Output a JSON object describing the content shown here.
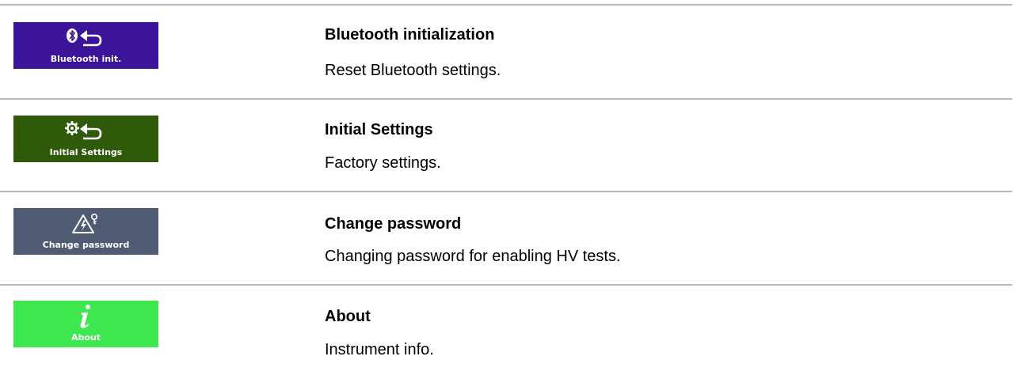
{
  "items": [
    {
      "tile_label": "Bluetooth init.",
      "tile_color": "#3b1499",
      "icon": "bluetooth-reset-icon",
      "title": "Bluetooth initialization",
      "description": "Reset Bluetooth settings."
    },
    {
      "tile_label": "Initial Settings",
      "tile_color": "#2f5a0a",
      "icon": "gear-reset-icon",
      "title": "Initial Settings",
      "description": "Factory settings."
    },
    {
      "tile_label": "Change password",
      "tile_color": "#4f5a73",
      "icon": "hv-password-icon",
      "title": "Change password",
      "description": "Changing password for enabling HV tests."
    },
    {
      "tile_label": "About",
      "tile_color": "#3ee650",
      "icon": "info-icon",
      "title": "About",
      "description": "Instrument info."
    }
  ],
  "colors": {
    "divider": "#b8b8b8",
    "text": "#000000",
    "tile_text": "#ffffff"
  }
}
